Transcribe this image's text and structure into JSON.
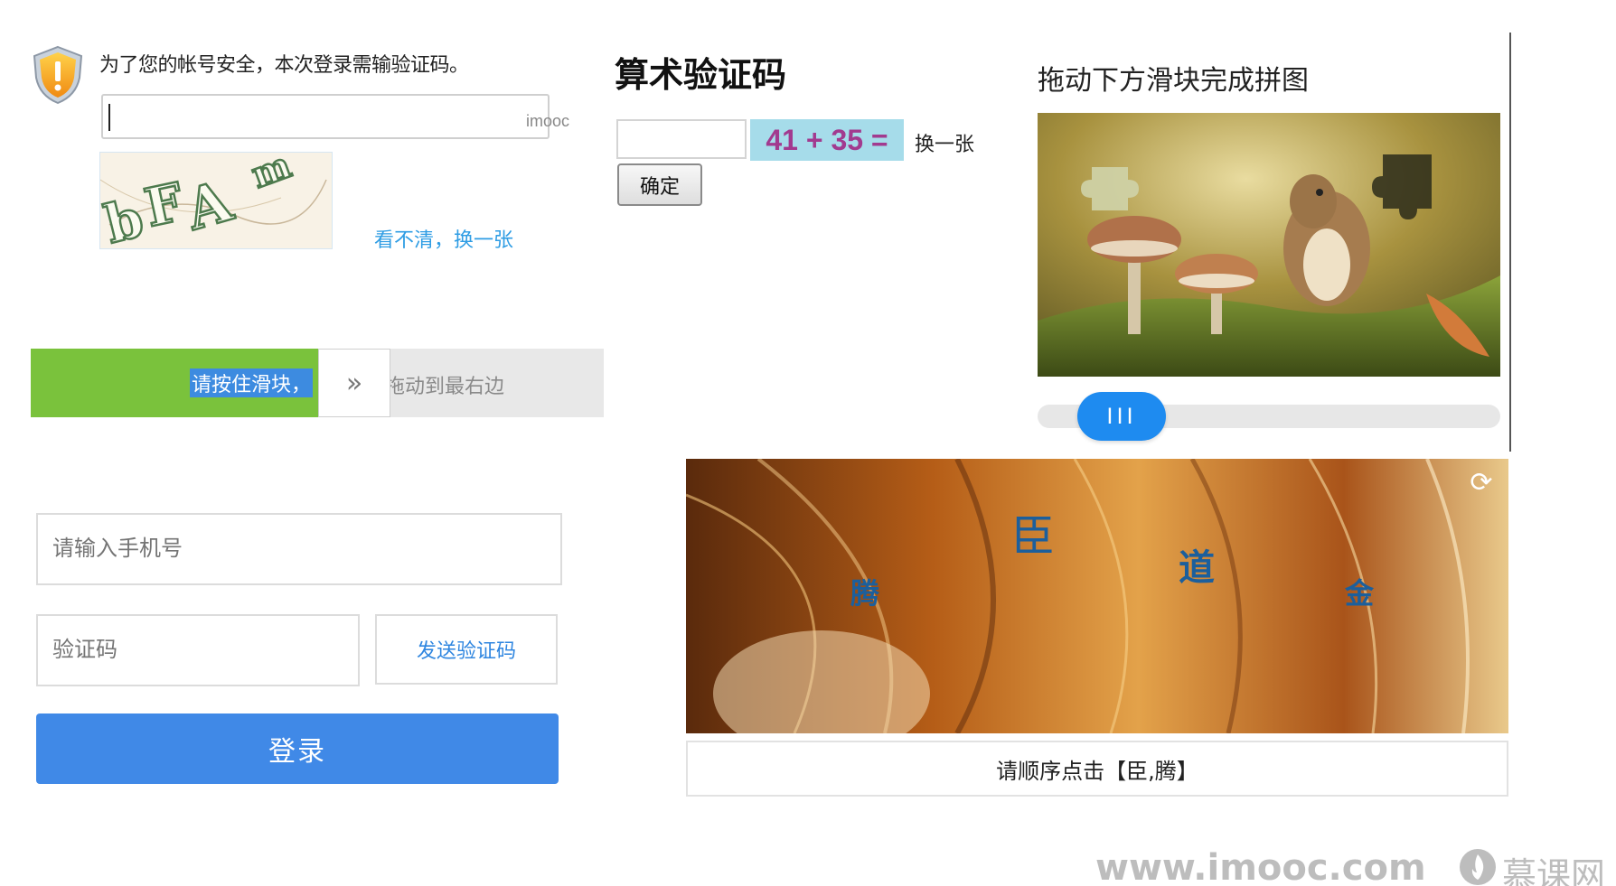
{
  "text_captcha": {
    "message": "为了您的帐号安全，本次登录需输验证码。",
    "input_value": "",
    "watermark": "imooc",
    "captcha_chars": [
      "b",
      "F",
      "A",
      "m"
    ],
    "refresh_label": "看不清，换一张",
    "shield_icon": "shield-warning-icon"
  },
  "slide_bar": {
    "hint_selected": "请按住滑块，",
    "hint_rest": "拖动到最右边",
    "handle_icon": "double-chevron-right-icon",
    "handle_glyph": "»",
    "fill_color": "#7ac23c",
    "progress": 0.5
  },
  "phone_login": {
    "phone_placeholder": "请输入手机号",
    "code_placeholder": "验证码",
    "send_code_label": "发送验证码",
    "login_label": "登录",
    "accent": "#4089e7"
  },
  "arithmetic_captcha": {
    "title": "算术验证码",
    "input_value": "",
    "expression": "41 + 35 =",
    "change_label": "换一张",
    "confirm_label": "确定"
  },
  "puzzle_slider": {
    "title": "拖动下方滑块完成拼图",
    "handle_glyph": "III",
    "handle_color": "#1e8bf0",
    "progress": 0.1
  },
  "click_captcha": {
    "chars": [
      "臣",
      "道",
      "腾",
      "金"
    ],
    "refresh_icon": "refresh-icon",
    "refresh_glyph": "⟳",
    "instruction": "请顺序点击【臣,腾】"
  },
  "footer": {
    "url": "www.imooc.com",
    "brand": "慕课网",
    "logo_icon": "imooc-flame-logo"
  }
}
